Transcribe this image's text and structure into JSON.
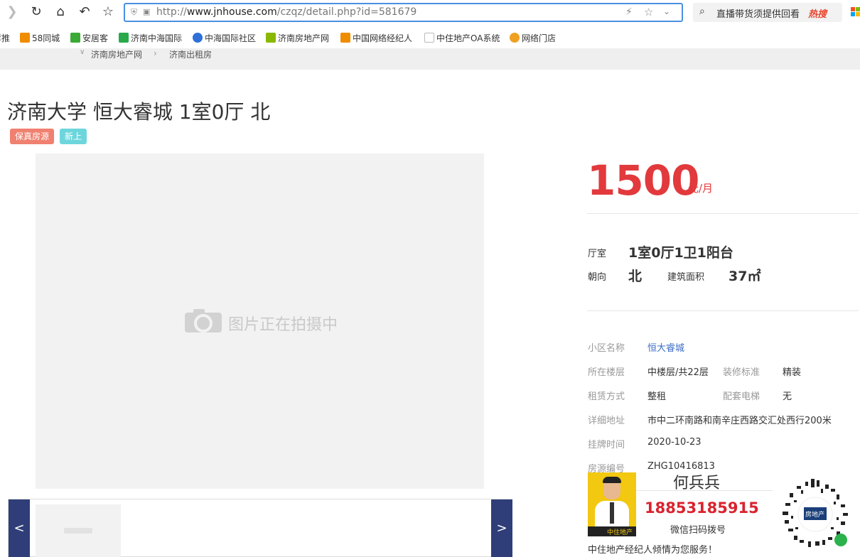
{
  "browser": {
    "url_domain": "www.jnhouse.com",
    "url_prefix": "http://",
    "url_path": "/czqz/detail.php?id=581679",
    "search_text": "直播带货须提供回看",
    "search_hot": "热搜"
  },
  "bookmarks": [
    {
      "label": "荐推",
      "color": "#e8442c"
    },
    {
      "label": "58同城",
      "color": "#f08c00"
    },
    {
      "label": "安居客",
      "color": "#3ba936"
    },
    {
      "label": "济南中海国际",
      "color": "#2aa94a"
    },
    {
      "label": "中海国际社区",
      "color": "#2e6fd8"
    },
    {
      "label": "济南房地产网",
      "color": "#8ab800"
    },
    {
      "label": "中国网络经纪人",
      "color": "#f08c00"
    },
    {
      "label": "中住地产OA系统",
      "color": "#cccccc"
    },
    {
      "label": "网络门店",
      "color": "#f0a020"
    }
  ],
  "breadcrumb": [
    "济南房地产网",
    "济南出租房"
  ],
  "listing": {
    "title": "济南大学 恒大睿城 1室0厅 北",
    "tags": [
      {
        "label": "保真房源",
        "color": "#f08070"
      },
      {
        "label": "新上",
        "color": "#6dd6dc"
      }
    ],
    "photo_placeholder": "图片正在拍摄中",
    "prev": "<",
    "next": ">",
    "price": "1500",
    "price_unit": "元/月",
    "layout_label": "厅室",
    "layout_value": "1室0厅1卫1阳台",
    "orientation_label": "朝向",
    "orientation_value": "北",
    "area_label": "建筑面积",
    "area_value": "37㎡",
    "details": {
      "community_label": "小区名称",
      "community_value": "恒大睿城",
      "floor_label": "所在楼层",
      "floor_value": "中楼层/共22层",
      "decoration_label": "装修标准",
      "decoration_value": "精装",
      "rent_type_label": "租赁方式",
      "rent_type_value": "整租",
      "elevator_label": "配套电梯",
      "elevator_value": "无",
      "address_label": "详细地址",
      "address_value": "市中二环南路和南辛庄西路交汇处西行200米",
      "listed_label": "挂牌时间",
      "listed_value": "2020-10-23",
      "code_label": "房源编号",
      "code_value": "ZHG10416813"
    }
  },
  "agent": {
    "name": "何兵兵",
    "phone": "18853185915",
    "scan_text": "微信扫码拨号",
    "photo_caption": "中住地产",
    "qr_caption": "房地产",
    "service_text": "中住地产经纪人倾情为您服务！"
  },
  "colors": {
    "accent": "#e2393d",
    "link": "#3a6bc4",
    "nav_arrow": "#2f3e78"
  }
}
